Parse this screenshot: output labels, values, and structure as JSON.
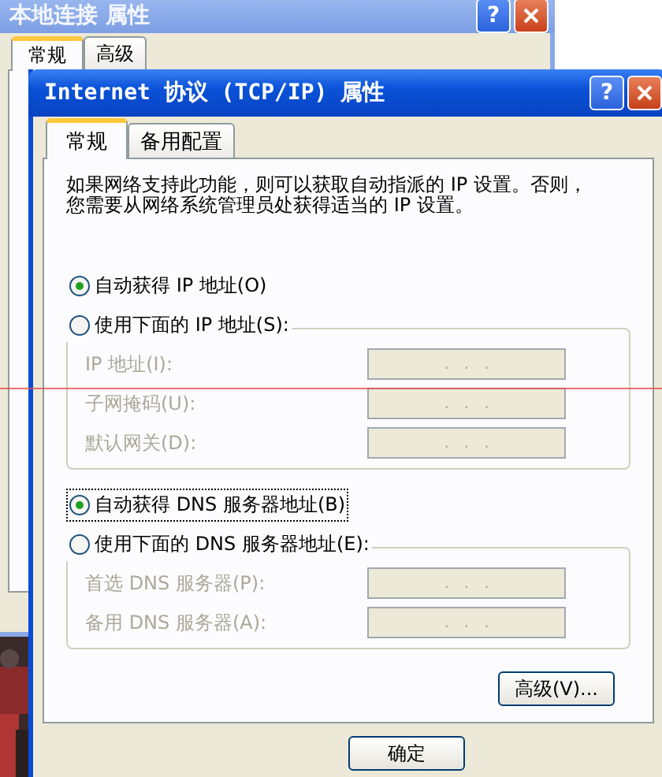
{
  "background_window": {
    "title": "本地连接 属性",
    "help": "?",
    "tabs": [
      {
        "label": "常规",
        "selected": true
      },
      {
        "label": "高级",
        "selected": false
      }
    ]
  },
  "dialog": {
    "title": "Internet 协议 (TCP/IP) 属性",
    "help": "?",
    "tabs": [
      {
        "label": "常规",
        "selected": true
      },
      {
        "label": "备用配置",
        "selected": false
      }
    ],
    "description": [
      "如果网络支持此功能，则可以获取自动指派的 IP 设置。否则，",
      "您需要从网络系统管理员处获得适当的 IP 设置。"
    ],
    "groups": [
      {
        "options": [
          {
            "label": "自动获得 IP 地址(O)",
            "selected": true,
            "focused": false
          },
          {
            "label": "使用下面的 IP 地址(S):",
            "selected": false,
            "focused": false
          }
        ],
        "fields": [
          {
            "label": "IP 地址(I):",
            "value": ".   .   .",
            "disabled": true
          },
          {
            "label": "子网掩码(U):",
            "value": ".   .   .",
            "disabled": true
          },
          {
            "label": "默认网关(D):",
            "value": ".   .   .",
            "disabled": true
          }
        ]
      },
      {
        "options": [
          {
            "label": "自动获得 DNS 服务器地址(B)",
            "selected": true,
            "focused": true
          },
          {
            "label": "使用下面的 DNS 服务器地址(E):",
            "selected": false,
            "focused": false
          }
        ],
        "fields": [
          {
            "label": "首选 DNS 服务器(P):",
            "value": ".   .   .",
            "disabled": true
          },
          {
            "label": "备用 DNS 服务器(A):",
            "value": ".   .   .",
            "disabled": true
          }
        ]
      }
    ],
    "advanced_button": "高级(V)...",
    "buttons": [
      "确定"
    ]
  }
}
